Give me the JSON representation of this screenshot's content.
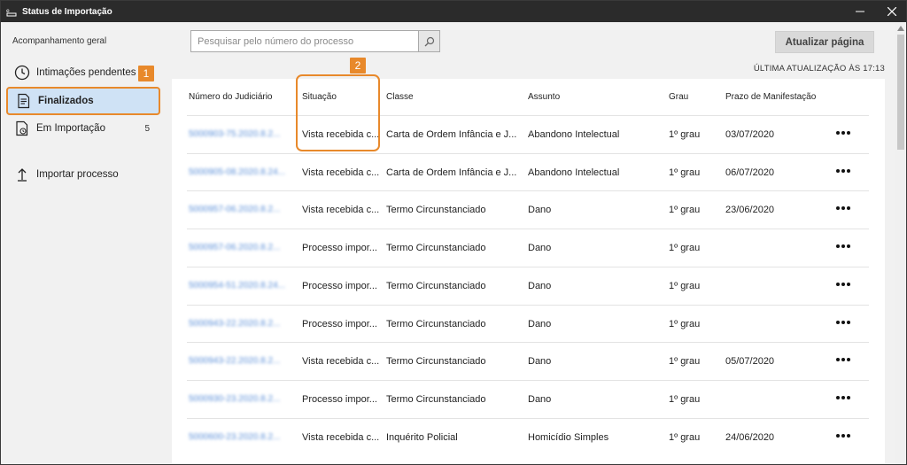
{
  "window": {
    "title": "Status de Importação"
  },
  "sidebar": {
    "header": "Acompanhamento geral",
    "items": [
      {
        "label": "Intimações pendentes",
        "icon": "clock-icon",
        "badge": ""
      },
      {
        "label": "Finalizados",
        "icon": "document-list-icon",
        "badge": "",
        "active": true
      },
      {
        "label": "Em Importação",
        "icon": "document-progress-icon",
        "badge": "5"
      },
      {
        "label": "Importar processo",
        "icon": "upload-arrow-icon",
        "badge": ""
      }
    ]
  },
  "markers": {
    "one": "1",
    "two": "2"
  },
  "search": {
    "placeholder": "Pesquisar pelo número do processo",
    "value": ""
  },
  "toolbar": {
    "refresh_label": "Atualizar página"
  },
  "status": {
    "last_update": "ÚLTIMA ATUALIZAÇÃO ÀS 17:13"
  },
  "table": {
    "headers": [
      "Número do Judiciário",
      "Situação",
      "Classe",
      "Assunto",
      "Grau",
      "Prazo de Manifestação"
    ],
    "rows": [
      {
        "numero": "5000903-75.2020.8.2...",
        "situacao": "Vista recebida c...",
        "classe": "Carta de Ordem Infância e J...",
        "assunto": "Abandono Intelectual",
        "grau": "1º grau",
        "prazo": "03/07/2020"
      },
      {
        "numero": "5000905-08.2020.8.24...",
        "situacao": "Vista recebida c...",
        "classe": "Carta de Ordem Infância e J...",
        "assunto": "Abandono Intelectual",
        "grau": "1º grau",
        "prazo": "06/07/2020"
      },
      {
        "numero": "5000957-06.2020.8.2...",
        "situacao": "Vista recebida c...",
        "classe": "Termo Circunstanciado",
        "assunto": "Dano",
        "grau": "1º grau",
        "prazo": "23/06/2020"
      },
      {
        "numero": "5000957-06.2020.8.2...",
        "situacao": "Processo impor...",
        "classe": "Termo Circunstanciado",
        "assunto": "Dano",
        "grau": "1º grau",
        "prazo": ""
      },
      {
        "numero": "5000954-51.2020.8.24...",
        "situacao": "Processo impor...",
        "classe": "Termo Circunstanciado",
        "assunto": "Dano",
        "grau": "1º grau",
        "prazo": ""
      },
      {
        "numero": "5000943-22.2020.8.2...",
        "situacao": "Processo impor...",
        "classe": "Termo Circunstanciado",
        "assunto": "Dano",
        "grau": "1º grau",
        "prazo": ""
      },
      {
        "numero": "5000943-22.2020.8.2...",
        "situacao": "Vista recebida c...",
        "classe": "Termo Circunstanciado",
        "assunto": "Dano",
        "grau": "1º grau",
        "prazo": "05/07/2020"
      },
      {
        "numero": "5000930-23.2020.8.2...",
        "situacao": "Processo impor...",
        "classe": "Termo Circunstanciado",
        "assunto": "Dano",
        "grau": "1º grau",
        "prazo": ""
      },
      {
        "numero": "5000600-23.2020.8.2...",
        "situacao": "Vista recebida c...",
        "classe": "Inquérito Policial",
        "assunto": "Homicídio Simples",
        "grau": "1º grau",
        "prazo": "24/06/2020"
      }
    ]
  },
  "colors": {
    "accent": "#e8892b",
    "active_bg": "#cfe2f5",
    "titlebar": "#2b2b2b"
  }
}
